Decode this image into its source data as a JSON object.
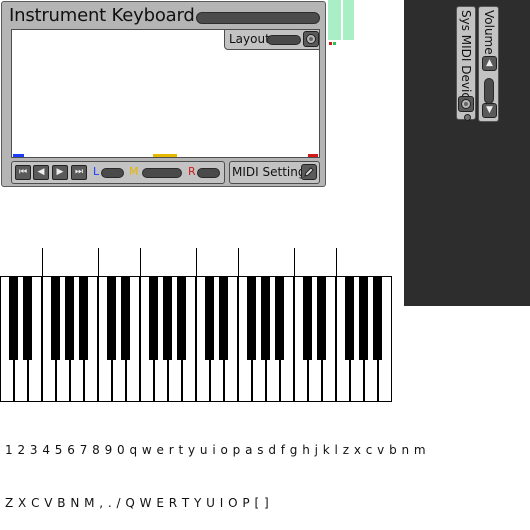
{
  "window": {
    "title": "Instrument Keyboard",
    "layout_label": "Layout",
    "midi_settings_label": "MIDI Settings",
    "transport_buttons": [
      "⏮",
      "◀",
      "▶",
      "⏭"
    ],
    "channel_labels": {
      "left": "L",
      "middle": "M",
      "right": "R"
    }
  },
  "side_panel": {
    "volume_label": "Volume",
    "sys_midi_label": "Sys MIDI Device",
    "up_arrow": "▲",
    "down_arrow": "▼"
  },
  "colors": {
    "left_channel": "#1a3cff",
    "middle_channel": "#e6b800",
    "right_channel": "#d21a1a",
    "mint": "#a9efc6",
    "panel_bg": "#2d2d2d"
  },
  "key_mapping": {
    "row_lower": "1 2 3 4 5 6 7 8 9 0 q w e r t y u i o p a s d f g h j k l z x c v b n m",
    "row_upper": "Z X C V B N M , . / Q W E R T Y U I O P [ ]"
  }
}
